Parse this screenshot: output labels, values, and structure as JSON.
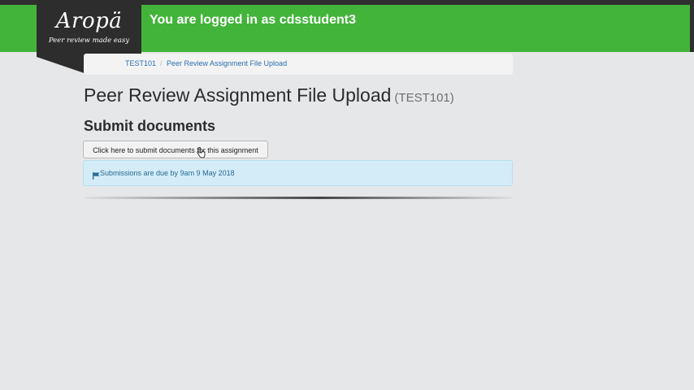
{
  "header": {
    "logo_title": "Aropä",
    "logo_tagline": "Peer review made easy",
    "logged_prefix": "You are logged in as ",
    "username": "cdsstudent3"
  },
  "breadcrumb": {
    "items": [
      "TEST101",
      "Peer Review Assignment File Upload"
    ],
    "separator": "/"
  },
  "main": {
    "page_title": "Peer Review Assignment File Upload",
    "course_code": "(TEST101)",
    "section_title": "Submit documents",
    "submit_button": "Click here to submit documents for this assignment",
    "alert_text": "Submissions are due by 9am 9 May 2018"
  },
  "icons": {
    "alert": "flag-icon",
    "pointer": "hand-cursor-icon"
  },
  "colors": {
    "header_green": "#42b43a",
    "logo_dark": "#2d2d2d",
    "link_blue": "#2a6fb0",
    "alert_bg": "#d3ecf7"
  }
}
